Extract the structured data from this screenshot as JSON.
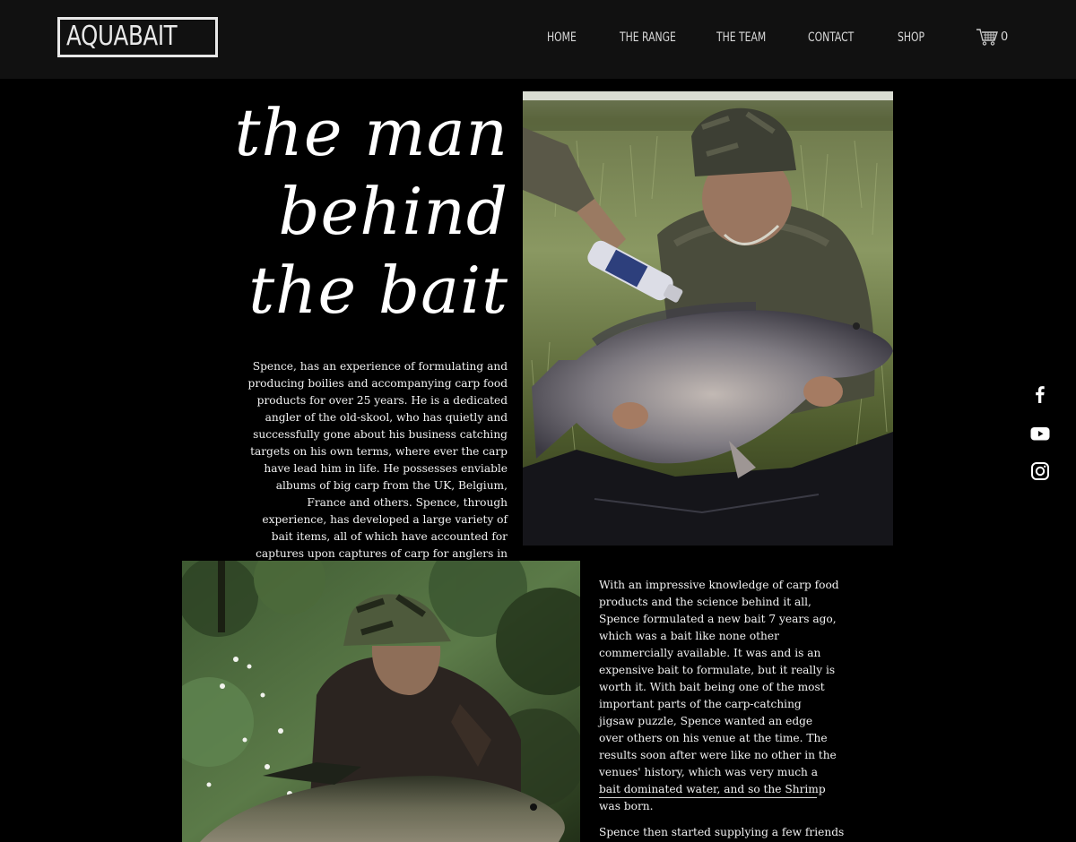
{
  "brand": {
    "logo_text": "AQUABAIT"
  },
  "nav": {
    "items": [
      {
        "label": "HOME"
      },
      {
        "label": "THE RANGE"
      },
      {
        "label": "THE TEAM"
      },
      {
        "label": "CONTACT"
      },
      {
        "label": "SHOP"
      }
    ],
    "cart_count": "0"
  },
  "hero": {
    "title_lines": [
      "the man",
      "behind",
      "the bait"
    ]
  },
  "intro": {
    "text": "Spence, has an experience of formulating and producing boilies and accompanying carp food products for over 25 years. He is a dedicated angler of the old-skool, who has quietly and successfully gone about his business catching targets on his own terms, where ever the carp have lead him in life. He possesses enviable albums of big carp from the UK, Belgium, France and others. Spence, through experience, has developed a large variety of bait items, all of which have accounted for captures upon captures of carp for anglers in the UK and overseas."
  },
  "story": {
    "text": "With an impressive knowledge of carp food products and the science behind it all, Spence formulated a new bait 7 years ago, which was a bait like none other commercially available. It was and is an expensive bait to formulate, but it really is worth it. With bait being one of the most important parts of the carp-catching jigsaw puzzle, Spence wanted an edge over others on his venue at the time. The results soon after were like no other in the venues' history, which was very much a bait dominated water, and so the Shrimp was born.",
    "continuation": "Spence then started supplying a few friends"
  },
  "social": [
    {
      "icon": "facebook-icon"
    },
    {
      "icon": "youtube-icon"
    },
    {
      "icon": "instagram-icon"
    }
  ],
  "colors": {
    "header_bg": "#111111",
    "page_bg": "#000000",
    "text": "#f2f2f2"
  }
}
